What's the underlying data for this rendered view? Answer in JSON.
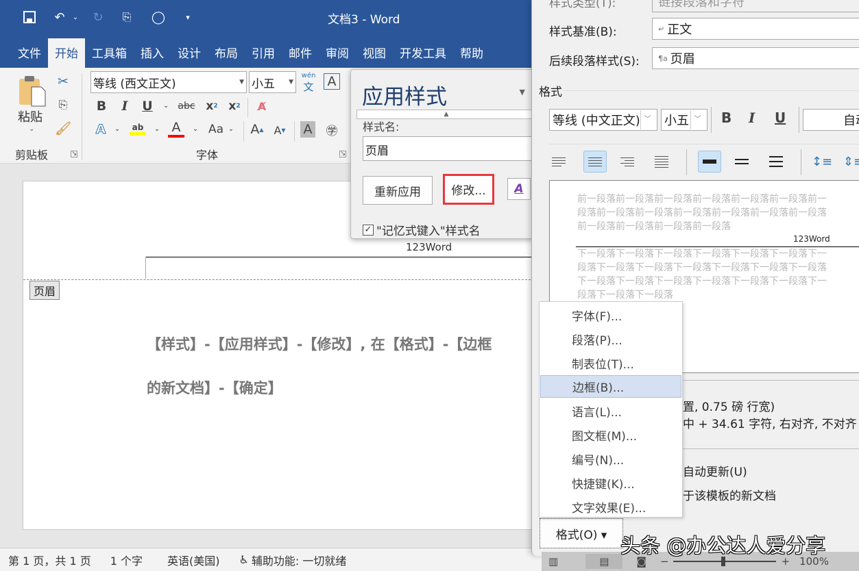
{
  "titlebar": {
    "title": "文档3  -  Word",
    "quick_access": [
      "save-icon",
      "undo-icon",
      "redo-icon",
      "touch-mode-icon",
      "circle-icon",
      "customize-icon"
    ]
  },
  "tabs": [
    "文件",
    "开始",
    "工具箱",
    "插入",
    "设计",
    "布局",
    "引用",
    "邮件",
    "审阅",
    "视图",
    "开发工具",
    "帮助"
  ],
  "active_tab": "开始",
  "ribbon": {
    "clipboard": {
      "paste_label": "粘贴",
      "group_label": "剪贴板"
    },
    "font": {
      "font_name": "等线 (西文正文)",
      "font_size": "小五",
      "group_label": "字体",
      "phonetic_label": "wén",
      "phonetic_char": "文"
    },
    "colors": {
      "highlight": "#ffff00",
      "font_color": "#ff0000"
    }
  },
  "document": {
    "header_text": "123Word",
    "header_tag": "页眉",
    "body_lines": [
      "【样式】-【应用样式】-【修改】, 在【格式】-【边框",
      "的新文档】-【确定】"
    ]
  },
  "status": {
    "page": "第 1 页，共 1 页",
    "words": "1 个字",
    "language": "英语(美国)",
    "accessibility": "辅助功能: 一切就绪",
    "zoom": "100%"
  },
  "apply_style": {
    "title": "应用样式",
    "name_label": "样式名:",
    "name_value": "页眉",
    "reapply": "重新应用",
    "modify": "修改...",
    "autocomplete_label": "\"记忆式键入\"样式名",
    "autocomplete_checked": true
  },
  "modify_dialog": {
    "style_type_label": "样式类型(T):",
    "style_type_value": "链接段落和字符",
    "based_on_label": "样式基准(B):",
    "based_on_value": "正文",
    "next_style_label": "后续段落样式(S):",
    "next_style_value": "页眉",
    "format_label": "格式",
    "font": "等线 (中文正文)",
    "size": "小五",
    "color": "自动",
    "preview_prev": [
      "前一段落前一段落前一段落前一段落前一段落前一段落前一",
      "段落前一段落前一段落前一段落前一段落前一段落前一段落",
      "前一段落前一段落前一段落前一段落"
    ],
    "preview_sample": "123Word",
    "preview_next": [
      "下一段落下一段落下一段落下一段落下一段落下一段落下一",
      "段落下一段落下一段落下一段落下一段落下一段落下一段落",
      "下一段落下一段落下一段落下一段落下一段落下一段落下一",
      "段落下一段落下一段落"
    ],
    "desc_line1": "置, 0.75 磅 行宽)",
    "desc_line2": "中 +  34.61 字符, 右对齐, 不对齐",
    "auto_update": "自动更新(U)",
    "template_option": "于该模板的新文档",
    "format_button": "格式(O) ▾"
  },
  "format_menu": [
    "字体(F)...",
    "段落(P)...",
    "制表位(T)...",
    "边框(B)...",
    "语言(L)...",
    "图文框(M)...",
    "编号(N)...",
    "快捷键(K)...",
    "文字效果(E)..."
  ],
  "format_menu_highlighted": 3,
  "watermark": "头条 @办公达人爱分享"
}
